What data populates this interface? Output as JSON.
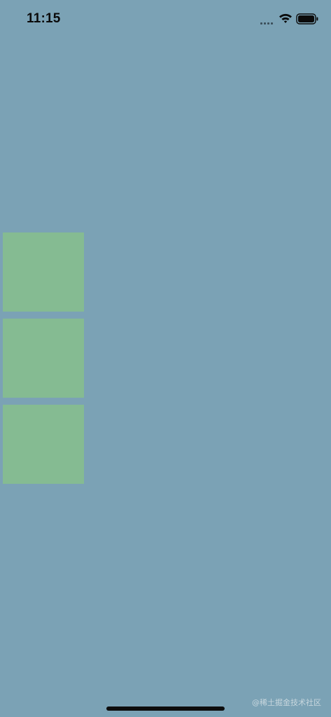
{
  "status_bar": {
    "time": "11:15",
    "icons": [
      "signal-icon",
      "wifi-icon",
      "battery-icon"
    ]
  },
  "content": {
    "squares": [
      {
        "name": "square-1",
        "color": "#85bb92"
      },
      {
        "name": "square-2",
        "color": "#85bb92"
      },
      {
        "name": "square-3",
        "color": "#85bb92"
      }
    ]
  },
  "background_color": "#7ba2b5",
  "watermark": "@稀土掘金技术社区"
}
